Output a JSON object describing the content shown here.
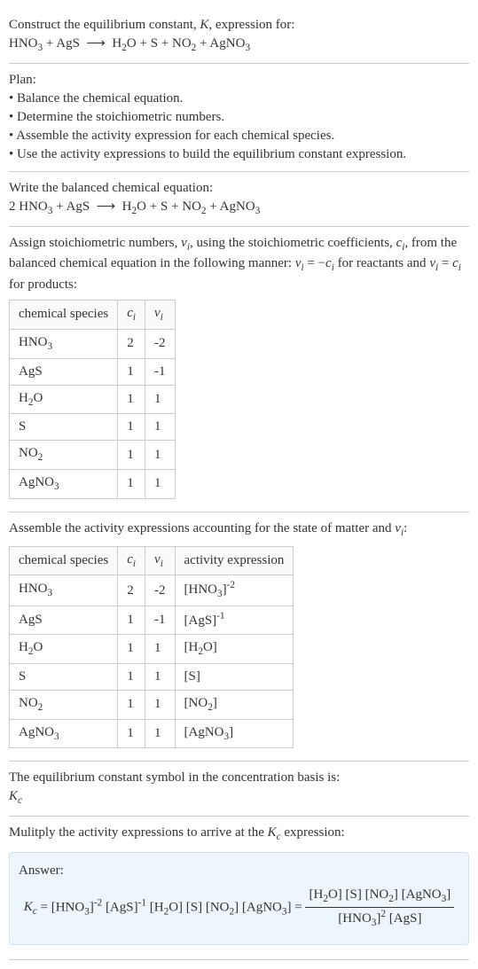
{
  "intro": {
    "line1": "Construct the equilibrium constant, ",
    "Ksym": "K",
    "line1b": ", expression for:",
    "equation_left": "HNO",
    "equation": "HNO₃ + AgS ⟶ H₂O + S + NO₂ + AgNO₃"
  },
  "plan": {
    "title": "Plan:",
    "items": [
      "• Balance the chemical equation.",
      "• Determine the stoichiometric numbers.",
      "• Assemble the activity expression for each chemical species.",
      "• Use the activity expressions to build the equilibrium constant expression."
    ]
  },
  "balanced": {
    "title": "Write the balanced chemical equation:",
    "equation": "2 HNO₃ + AgS ⟶ H₂O + S + NO₂ + AgNO₃"
  },
  "stoich": {
    "intro": "Assign stoichiometric numbers, νᵢ, using the stoichiometric coefficients, cᵢ, from the balanced chemical equation in the following manner: νᵢ = −cᵢ for reactants and νᵢ = cᵢ for products:",
    "headers": {
      "species": "chemical species",
      "ci": "cᵢ",
      "vi": "νᵢ"
    },
    "rows": [
      {
        "species": "HNO₃",
        "ci": "2",
        "vi": "-2"
      },
      {
        "species": "AgS",
        "ci": "1",
        "vi": "-1"
      },
      {
        "species": "H₂O",
        "ci": "1",
        "vi": "1"
      },
      {
        "species": "S",
        "ci": "1",
        "vi": "1"
      },
      {
        "species": "NO₂",
        "ci": "1",
        "vi": "1"
      },
      {
        "species": "AgNO₃",
        "ci": "1",
        "vi": "1"
      }
    ]
  },
  "activity": {
    "intro": "Assemble the activity expressions accounting for the state of matter and νᵢ:",
    "headers": {
      "species": "chemical species",
      "ci": "cᵢ",
      "vi": "νᵢ",
      "act": "activity expression"
    },
    "rows": [
      {
        "species": "HNO₃",
        "ci": "2",
        "vi": "-2",
        "act": "[HNO₃]⁻²"
      },
      {
        "species": "AgS",
        "ci": "1",
        "vi": "-1",
        "act": "[AgS]⁻¹"
      },
      {
        "species": "H₂O",
        "ci": "1",
        "vi": "1",
        "act": "[H₂O]"
      },
      {
        "species": "S",
        "ci": "1",
        "vi": "1",
        "act": "[S]"
      },
      {
        "species": "NO₂",
        "ci": "1",
        "vi": "1",
        "act": "[NO₂]"
      },
      {
        "species": "AgNO₃",
        "ci": "1",
        "vi": "1",
        "act": "[AgNO₃]"
      }
    ]
  },
  "ksymbol": {
    "line": "The equilibrium constant symbol in the concentration basis is:",
    "Kc": "Kc"
  },
  "multiply": {
    "line": "Mulitply the activity expressions to arrive at the Kc expression:"
  },
  "answer": {
    "label": "Answer:",
    "lhs": "Kc = [HNO₃]⁻² [AgS]⁻¹ [H₂O] [S] [NO₂] [AgNO₃] = ",
    "num": "[H₂O] [S] [NO₂] [AgNO₃]",
    "den": "[HNO₃]² [AgS]"
  },
  "chart_data": {
    "type": "table",
    "tables": [
      {
        "title": "Stoichiometric numbers",
        "columns": [
          "chemical species",
          "c_i",
          "ν_i"
        ],
        "rows": [
          [
            "HNO3",
            2,
            -2
          ],
          [
            "AgS",
            1,
            -1
          ],
          [
            "H2O",
            1,
            1
          ],
          [
            "S",
            1,
            1
          ],
          [
            "NO2",
            1,
            1
          ],
          [
            "AgNO3",
            1,
            1
          ]
        ]
      },
      {
        "title": "Activity expressions",
        "columns": [
          "chemical species",
          "c_i",
          "ν_i",
          "activity expression"
        ],
        "rows": [
          [
            "HNO3",
            2,
            -2,
            "[HNO3]^-2"
          ],
          [
            "AgS",
            1,
            -1,
            "[AgS]^-1"
          ],
          [
            "H2O",
            1,
            1,
            "[H2O]"
          ],
          [
            "S",
            1,
            1,
            "[S]"
          ],
          [
            "NO2",
            1,
            1,
            "[NO2]"
          ],
          [
            "AgNO3",
            1,
            1,
            "[AgNO3]"
          ]
        ]
      }
    ]
  }
}
